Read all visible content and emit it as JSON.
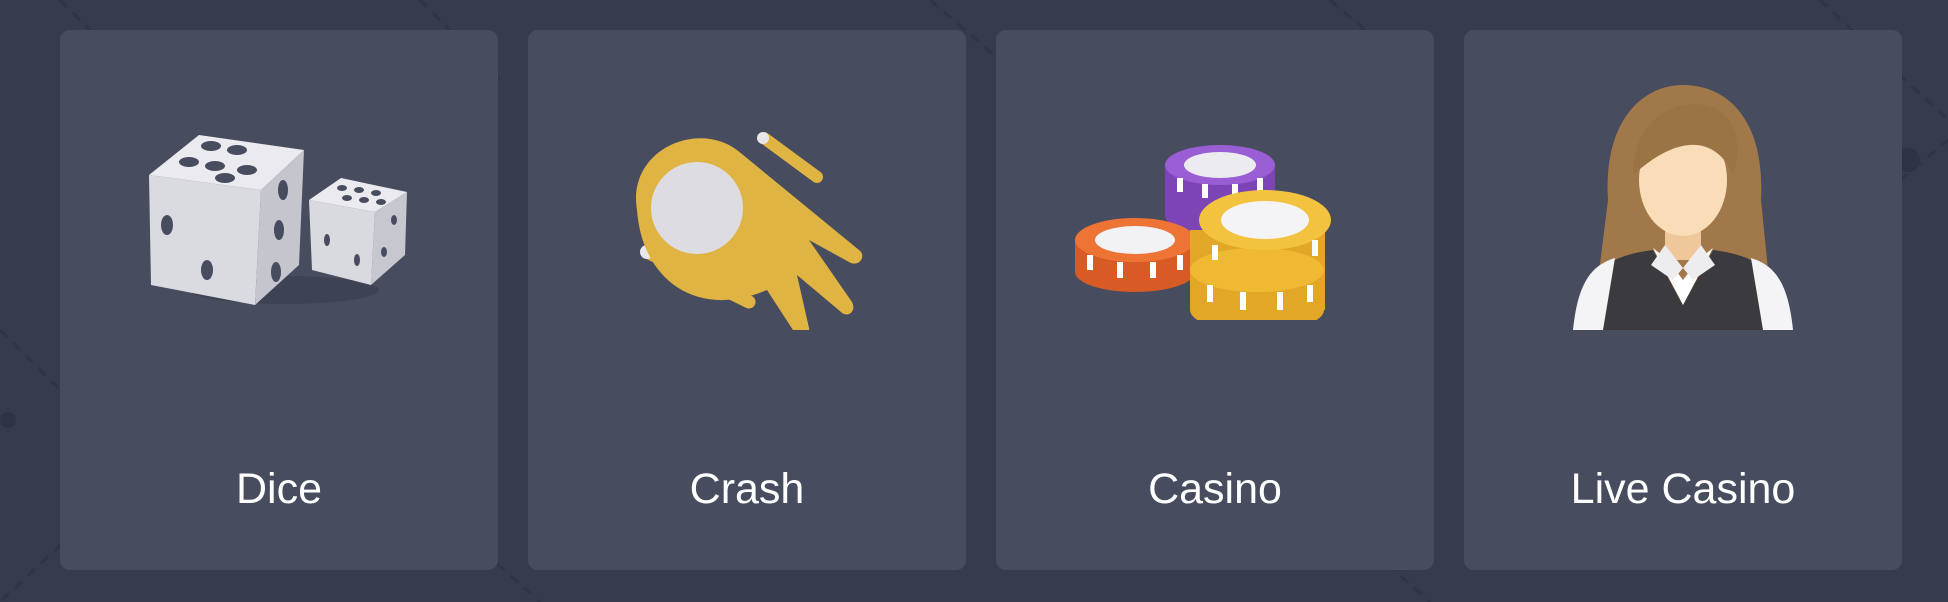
{
  "cards": [
    {
      "label": "Dice",
      "icon": "dice-icon"
    },
    {
      "label": "Crash",
      "icon": "comet-icon"
    },
    {
      "label": "Casino",
      "icon": "casino-chips-icon"
    },
    {
      "label": "Live Casino",
      "icon": "dealer-icon"
    }
  ],
  "colors": {
    "page_background": "#363c4e",
    "card_background": "#474c5f",
    "label_text": "#ffffff",
    "crash_gold": "#e0b443",
    "chip_purple": "#8e52c8",
    "chip_orange": "#e56a30",
    "chip_yellow": "#efb934"
  }
}
